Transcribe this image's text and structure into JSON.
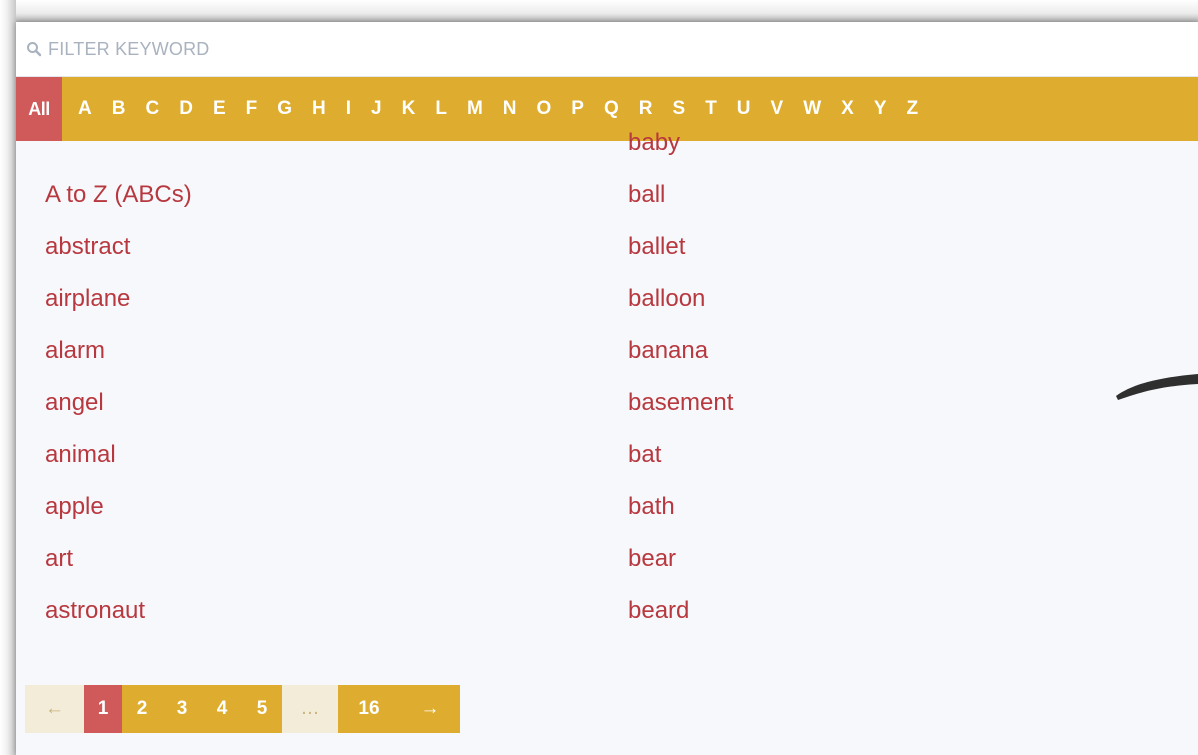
{
  "search": {
    "placeholder": "FILTER KEYWORD",
    "icon": "search-icon"
  },
  "letters": {
    "all_label": "All",
    "items": [
      "A",
      "B",
      "C",
      "D",
      "E",
      "F",
      "G",
      "H",
      "I",
      "J",
      "K",
      "L",
      "M",
      "N",
      "O",
      "P",
      "Q",
      "R",
      "S",
      "T",
      "U",
      "V",
      "W",
      "X",
      "Y",
      "Z"
    ]
  },
  "words": {
    "left": [
      "A to Z (ABCs)",
      "abstract",
      "airplane",
      "alarm",
      "angel",
      "animal",
      "apple",
      "art",
      "astronaut"
    ],
    "right": [
      "baby",
      "ball",
      "ballet",
      "balloon",
      "banana",
      "basement",
      "bat",
      "bath",
      "bear",
      "beard"
    ]
  },
  "pagination": {
    "prev": "←",
    "pages": [
      "1",
      "2",
      "3",
      "4",
      "5"
    ],
    "active_page": "1",
    "ellipsis": "…",
    "last": "16",
    "next": "→"
  },
  "colors": {
    "accent_yellow": "#deac2e",
    "active_red": "#d05a5a",
    "link_red": "#b8383f",
    "panel_bg": "#f6f8fb"
  }
}
